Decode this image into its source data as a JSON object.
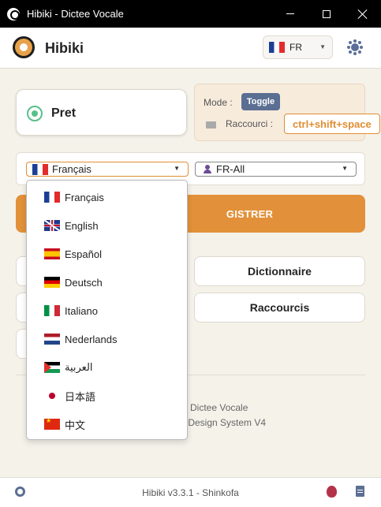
{
  "window": {
    "title": "Hibiki - Dictee Vocale"
  },
  "header": {
    "brand": "Hibiki",
    "ui_language": "FR"
  },
  "status": {
    "text": "Pret",
    "color": "#58c08a"
  },
  "mode": {
    "label": "Mode :",
    "button": "Toggle",
    "shortcut_label": "Raccourci :",
    "shortcut_value": "ctrl+shift+space"
  },
  "selectors": {
    "language": "Français",
    "voice": "FR-All"
  },
  "record": {
    "label": "ENREGISTRER",
    "visible_fragment": "GISTRER"
  },
  "grid": {
    "btn2": "Dictionnaire",
    "btn4": "Raccourcis"
  },
  "about": {
    "line1": "Dictee Vocale",
    "line2": "- Design System V4"
  },
  "footer": {
    "text": "Hibiki v3.3.1 - Shinkofa"
  },
  "dropdown": {
    "items": [
      {
        "label": "Français",
        "flag": "fr"
      },
      {
        "label": "English",
        "flag": "en"
      },
      {
        "label": "Español",
        "flag": "es"
      },
      {
        "label": "Deutsch",
        "flag": "de"
      },
      {
        "label": "Italiano",
        "flag": "it"
      },
      {
        "label": "Nederlands",
        "flag": "nl"
      },
      {
        "label": "العربية",
        "flag": "ar"
      },
      {
        "label": "日本語",
        "flag": "ja"
      },
      {
        "label": "中文",
        "flag": "zh"
      }
    ]
  },
  "colors": {
    "accent": "#e2913a",
    "primary": "#5b6f93",
    "background": "#f5f2ea"
  },
  "icons": {
    "theme": "sun-icon",
    "settings": "gear-icon",
    "report": "bug-icon",
    "docs": "document-icon"
  }
}
